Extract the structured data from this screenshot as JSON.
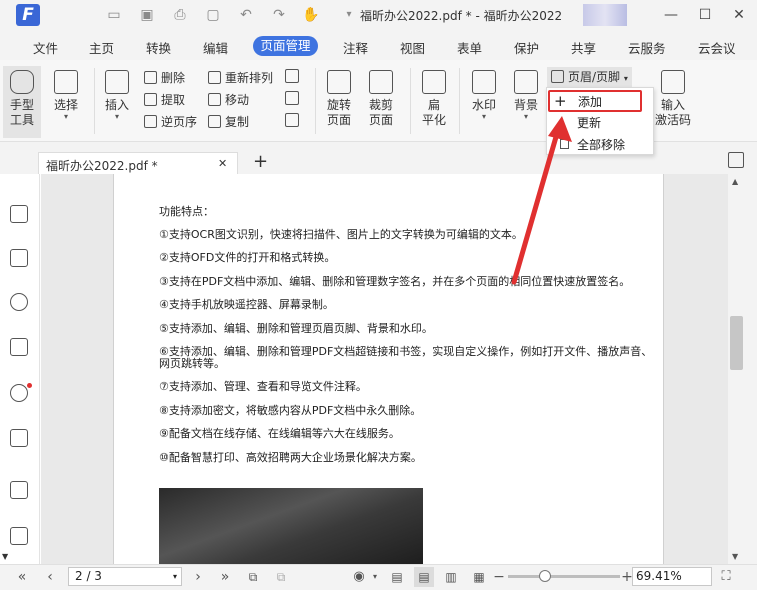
{
  "titlebar": {
    "logo": "F",
    "title": "福昕办公2022.pdf * - 福昕办公2022",
    "minimize": "—",
    "maximize": "☐",
    "close": "✕"
  },
  "menubar": {
    "items": [
      "文件",
      "主页",
      "转换",
      "编辑",
      "页面管理",
      "注释",
      "视图",
      "表单",
      "保护",
      "共享",
      "云服务",
      "云会议"
    ]
  },
  "ribbon": {
    "hand_tool": [
      "手型",
      "工具"
    ],
    "select_tool": "选择",
    "insert": "插入",
    "delete": "删除",
    "extract": "提取",
    "reverse_order": "逆页序",
    "reorder": "重新排列",
    "move": "移动",
    "copy": "复制",
    "rotate": [
      "旋转",
      "页面"
    ],
    "crop": [
      "裁剪",
      "页面"
    ],
    "flatten": [
      "扁",
      "平化"
    ],
    "watermark": "水印",
    "background": "背景",
    "header_footer": "页眉/页脚",
    "input_activation": [
      "输入",
      "激活码"
    ]
  },
  "dropdown": {
    "items": [
      "添加",
      "更新",
      "全部移除"
    ]
  },
  "tab": {
    "label": "福昕办公2022.pdf *",
    "close": "✕",
    "new": "+"
  },
  "document": {
    "heading": "功能特点：",
    "lines": [
      "①支持OCR图文识别，快速将扫描件、图片上的文字转换为可编辑的文本。",
      "②支持OFD文件的打开和格式转换。",
      "③支持在PDF文档中添加、编辑、删除和管理数字签名，并在多个页面的相同位置快速放置签名。",
      "④支持手机放映遥控器、屏幕录制。",
      "⑤支持添加、编辑、删除和管理页眉页脚、背景和水印。",
      "⑥支持添加、编辑、删除和管理PDF文档超链接和书签，实现自定义操作，例如打开文件、播放声音、",
      "网页跳转等。",
      "⑦支持添加、管理、查看和导览文件注释。",
      "⑧支持添加密文，将敏感内容从PDF文档中永久删除。",
      "⑨配备文档在线存储、在线编辑等六大在线服务。",
      "⑩配备智慧打印、高效招聘两大企业场景化解决方案。"
    ]
  },
  "statusbar": {
    "page": "2 / 3",
    "zoom": "69.41%"
  },
  "colors": {
    "accent": "#3e73e0",
    "highlight": "#e03030"
  }
}
